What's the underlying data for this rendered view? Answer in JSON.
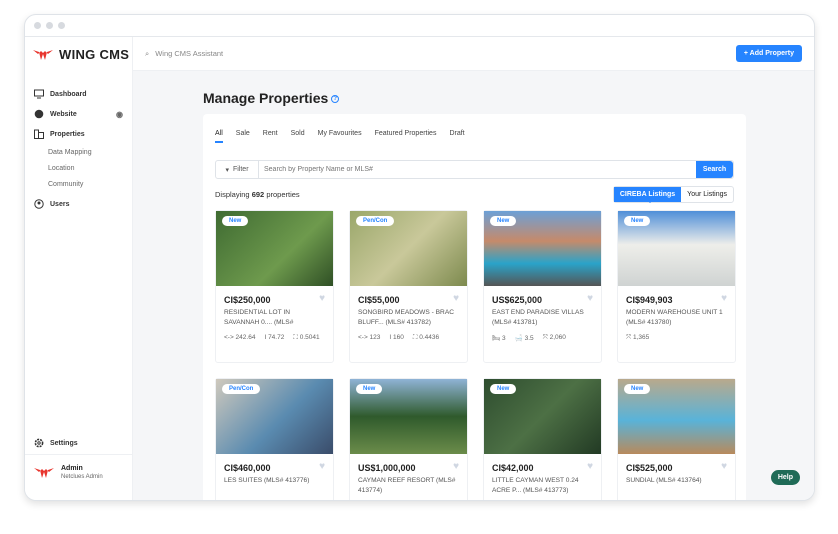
{
  "app": {
    "name": "WING CMS"
  },
  "sidebar": {
    "items": [
      {
        "label": "Dashboard"
      },
      {
        "label": "Website"
      },
      {
        "label": "Properties"
      }
    ],
    "subitems": [
      {
        "label": "Data Mapping"
      },
      {
        "label": "Location"
      },
      {
        "label": "Community"
      }
    ],
    "users": "Users",
    "settings": "Settings"
  },
  "user": {
    "name": "Admin",
    "role": "Netclues Admin"
  },
  "topbar": {
    "search_placeholder": "Wing CMS Assistant",
    "add_label": "+ Add Property"
  },
  "page": {
    "title": "Manage Properties",
    "help_icon": "?"
  },
  "tabs": [
    {
      "label": "All"
    },
    {
      "label": "Sale"
    },
    {
      "label": "Rent"
    },
    {
      "label": "Sold"
    },
    {
      "label": "My Favourites"
    },
    {
      "label": "Featured Properties"
    },
    {
      "label": "Draft"
    }
  ],
  "search": {
    "filter_label": "Filter",
    "placeholder": "Search by Property Name or MLS#",
    "button": "Search"
  },
  "display": {
    "prefix": "Displaying",
    "count": "692",
    "suffix": "properties"
  },
  "listing_toggle": {
    "cireba": "CIREBA Listings",
    "yours": "Your Listings"
  },
  "properties": [
    {
      "badge": "New",
      "price": "CI$250,000",
      "name": "Residential Lot in Savannah 0.... (MLS#",
      "meta": [
        "<-> 242.64",
        "I 74.72",
        "⛶ 0.5041"
      ]
    },
    {
      "badge": "Pen/Con",
      "price": "CI$55,000",
      "name": "Songbird Meadows - Brac Bluff... (MLS# 413782)",
      "meta": [
        "<-> 123",
        "I 160",
        "⛶ 0.4436"
      ]
    },
    {
      "badge": "New",
      "price": "US$625,000",
      "name": "East End Paradise Villas (MLS# 413781)",
      "meta": [
        "🛏 3",
        "🛁 3.5",
        "⤧ 2,060"
      ]
    },
    {
      "badge": "New",
      "price": "CI$949,903",
      "name": "Modern Warehouse Unit 1 (MLS# 413780)",
      "meta": [
        "⤧ 1,365"
      ]
    },
    {
      "badge": "Pen/Con",
      "price": "CI$460,000",
      "name": "Les Suites (MLS# 413776)",
      "meta": []
    },
    {
      "badge": "New",
      "price": "US$1,000,000",
      "name": "Cayman Reef Resort (MLS# 413774)",
      "meta": []
    },
    {
      "badge": "New",
      "price": "CI$42,000",
      "name": "Little Cayman West 0.24 Acre P... (MLS# 413773)",
      "meta": []
    },
    {
      "badge": "New",
      "price": "CI$525,000",
      "name": "Sundial (MLS# 413764)",
      "meta": []
    }
  ],
  "help": {
    "label": "Help"
  },
  "colors": {
    "accent": "#2684ff",
    "help": "#1f6b57"
  }
}
